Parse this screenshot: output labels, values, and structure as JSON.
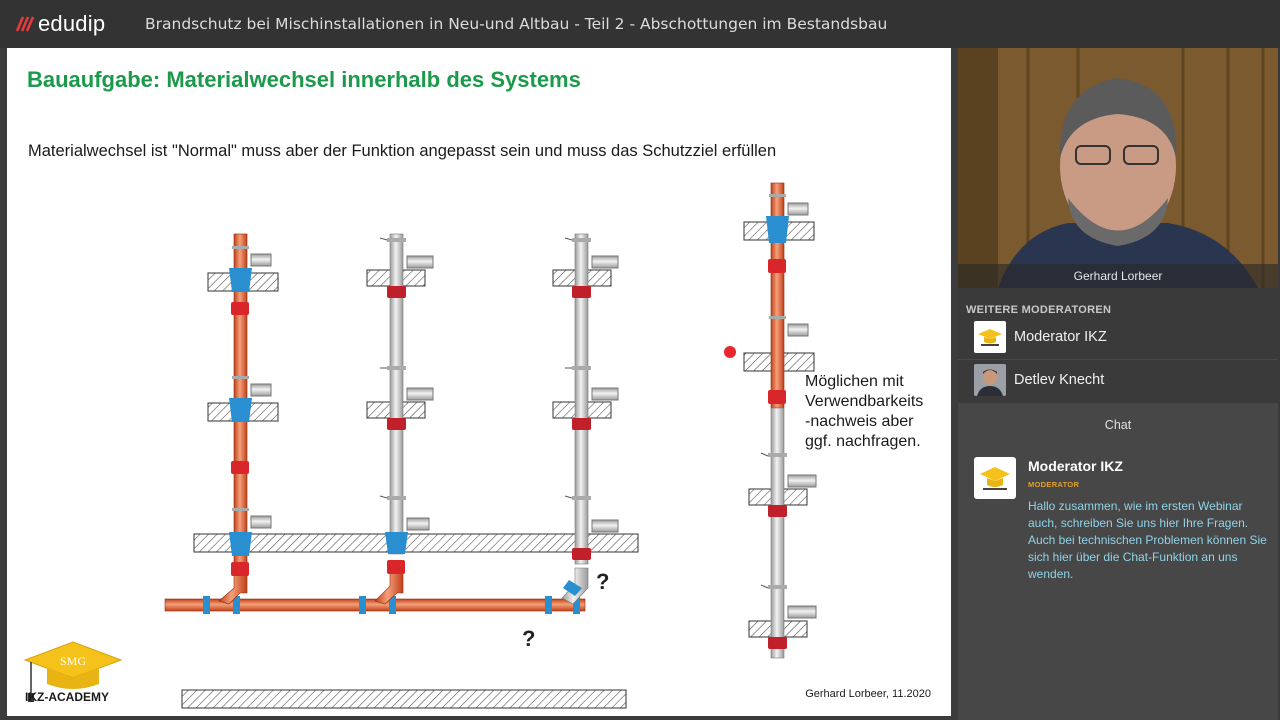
{
  "app": {
    "brand": "edudip",
    "title": "Brandschutz bei Mischinstallationen in Neu-und Altbau - Teil 2 - Abschottungen im Bestandsbau",
    "accent": "#e63b3b"
  },
  "slide": {
    "title": "Bauaufgabe: Materialwechsel innerhalb des Systems",
    "subtitle": "Materialwechsel ist \"Normal\" muss aber der Funktion angepasst sein und muss das Schutzziel erfüllen",
    "note_lines": [
      "Möglichen mit",
      "Verwendbarkeits",
      "-nachweis  aber",
      "ggf. nachfragen."
    ],
    "question_marks": [
      "?",
      "?"
    ],
    "credit": "Gerhard Lorbeer, 11.2020",
    "academy_badge": "SMG",
    "academy_name": "IKZ-ACADEMY",
    "colors": {
      "title": "#1a9a4a",
      "copper": "#e05a2a",
      "grey_pipe": "#c9c9c9",
      "coupling_blue": "#2a8fd0",
      "coupling_red": "#d9262a"
    }
  },
  "video": {
    "presenter_name": "Gerhard Lorbeer"
  },
  "moderators": {
    "heading": "WEITERE MODERATOREN",
    "items": [
      {
        "name": "Moderator IKZ",
        "icon": "graduation-cap-icon"
      },
      {
        "name": "Detlev Knecht",
        "icon": "person-avatar"
      }
    ]
  },
  "chat": {
    "title": "Chat",
    "messages": [
      {
        "author": "Moderator IKZ",
        "role": "MODERATOR",
        "text": "Hallo zusammen, wie im ersten Webinar auch, schreiben Sie uns hier Ihre Fragen. Auch bei technischen Problemen können Sie sich hier über die Chat-Funktion an uns wenden."
      }
    ]
  }
}
